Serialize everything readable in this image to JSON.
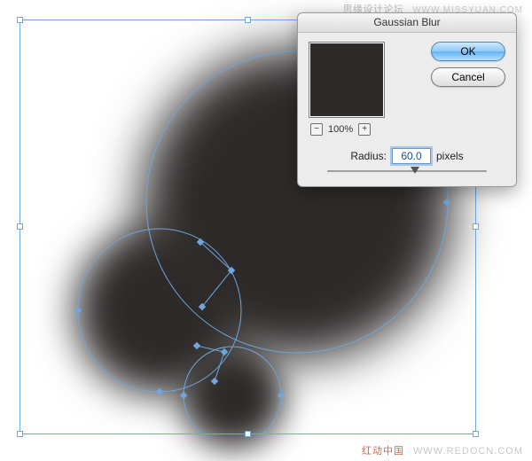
{
  "watermark": {
    "top_cn": "思缘设计论坛",
    "top_url": "WWW.MISSYUAN.COM",
    "bottom_cn": "红动中国",
    "bottom_url": "WWW.REDOCN.COM"
  },
  "dialog": {
    "title": "Gaussian Blur",
    "ok_label": "OK",
    "cancel_label": "Cancel",
    "zoom_pct": "100%",
    "zoom_out_glyph": "−",
    "zoom_in_glyph": "+",
    "radius_label": "Radius:",
    "radius_value": "60.0",
    "radius_units": "pixels",
    "slider_position_pct": 55
  },
  "colors": {
    "blob": "#2d2a29",
    "selection": "#6ea6dd",
    "primary_button": "#8fc9f7"
  }
}
